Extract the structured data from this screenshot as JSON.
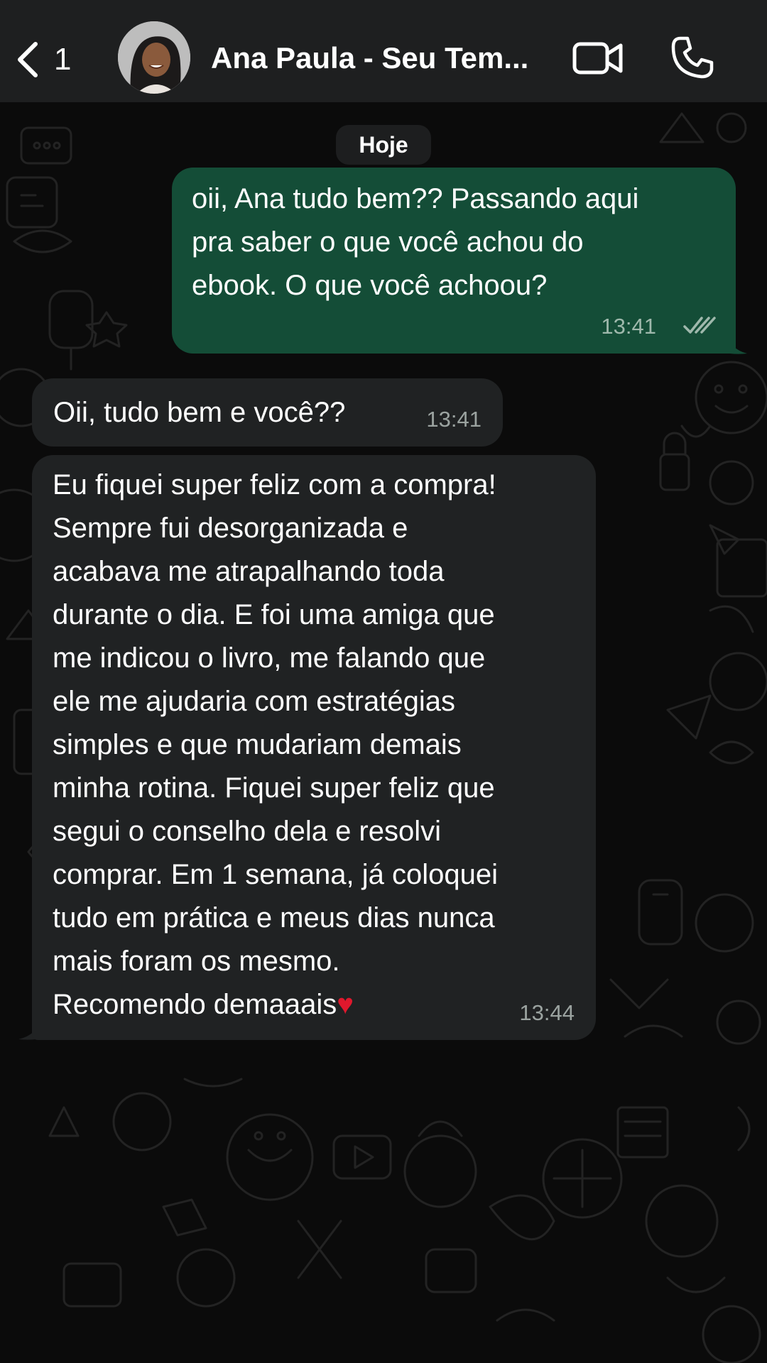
{
  "header": {
    "back_count": "1",
    "contact_name": "Ana Paula - Seu Tem...",
    "icons": [
      "chevron-left-icon",
      "video-camera-icon",
      "phone-icon"
    ]
  },
  "chat": {
    "date_label": "Hoje",
    "messages": [
      {
        "direction": "outgoing",
        "text": "oii, Ana tudo bem?? Passando aqui\npra saber o que você achou do\nebook. O que você achoou?",
        "time": "13:41",
        "status": "read"
      },
      {
        "direction": "incoming",
        "text": "Oii, tudo bem e você??",
        "time": "13:41"
      },
      {
        "direction": "incoming",
        "text": "Eu fiquei super feliz com a compra!\nSempre fui desorganizada e\nacabava me atrapalhando toda\ndurante o dia. E foi uma amiga que\nme indicou o livro, me falando que\nele me ajudaria com estratégias\nsimples e que mudariam demais\nminha rotina. Fiquei super feliz que\nsegui o conselho dela e resolvi\ncomprar. Em 1 semana, já coloquei\ntudo em prática e meus dias nunca\nmais foram os mesmo.\nRecomendo demaaais",
        "emoji": "♥",
        "time": "13:44"
      }
    ]
  },
  "colors": {
    "header_bg": "#1e1f20",
    "outgoing_bubble": "#144d37",
    "incoming_bubble": "#202223",
    "chat_bg": "#0b0b0b",
    "heart": "#e0182d"
  }
}
